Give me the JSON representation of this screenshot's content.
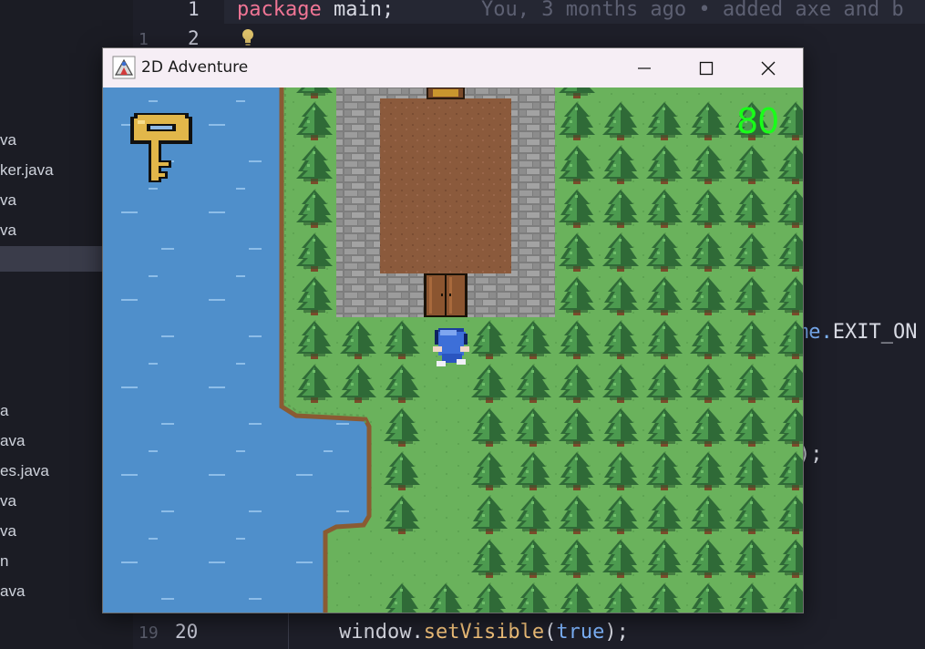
{
  "editor": {
    "explorer_items": [
      "va",
      "ker.java",
      "va",
      "va",
      "",
      "a",
      "ava",
      "es.java",
      "va",
      "va",
      "n",
      "ava"
    ],
    "code": {
      "line1_kw": "package",
      "line1_rest": " main;",
      "blame": "You, 3 months ago • added axe and b",
      "line_exit_obj": "me.",
      "line_exit_member": "EXIT_ON",
      "line_close": ");",
      "line20_obj": "window.",
      "line20_fn": "setVisible",
      "line20_open": "(",
      "line20_arg": "true",
      "line20_close": ");"
    },
    "line_numbers": {
      "top_left": "1",
      "top": "1",
      "second_left": "1",
      "second": "2",
      "bottom_left": "19",
      "bottom": "20"
    }
  },
  "window": {
    "title": "2D Adventure",
    "minimize_icon": "minimize-icon",
    "maximize_icon": "maximize-icon",
    "close_icon": "close-icon"
  },
  "game": {
    "counter": "80",
    "held_item": "key",
    "colors": {
      "water": "#4f8fcb",
      "grass": "#6ab25c",
      "tree_dark": "#2f6a37",
      "tree_light": "#4c9a4f",
      "stone": "#8f8f8f",
      "floor": "#8b5a3c",
      "counter_text": "#19ff19"
    }
  }
}
